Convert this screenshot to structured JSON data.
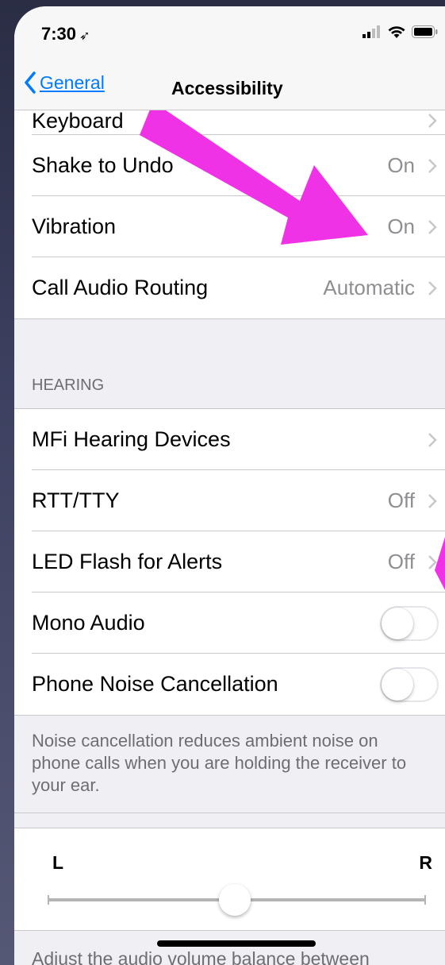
{
  "status_bar": {
    "time": "7:30",
    "location_icon": "location-arrow-icon",
    "signal_icon": "cellular-signal-icon",
    "wifi_icon": "wifi-icon",
    "battery_icon": "battery-icon"
  },
  "nav": {
    "back_label": "General",
    "title": "Accessibility"
  },
  "partial_top_row": "Keyboard",
  "interaction_rows": [
    {
      "label": "Shake to Undo",
      "value": "On"
    },
    {
      "label": "Vibration",
      "value": "On"
    },
    {
      "label": "Call Audio Routing",
      "value": "Automatic"
    }
  ],
  "hearing": {
    "header": "HEARING",
    "rows": [
      {
        "label": "MFi Hearing Devices",
        "value": ""
      },
      {
        "label": "RTT/TTY",
        "value": "Off"
      },
      {
        "label": "LED Flash for Alerts",
        "value": "Off"
      }
    ],
    "mono_audio": {
      "label": "Mono Audio",
      "on": false
    },
    "noise_cancel": {
      "label": "Phone Noise Cancellation",
      "on": false
    },
    "footer": "Noise cancellation reduces ambient noise on phone calls when you are holding the receiver to your ear."
  },
  "balance": {
    "left_label": "L",
    "right_label": "R",
    "value": 0.5,
    "footer_partial": "Adjust the audio volume balance between"
  },
  "colors": {
    "accent": "#007aff",
    "annotation_arrow": "#f032e6",
    "background": "#efeff4"
  }
}
